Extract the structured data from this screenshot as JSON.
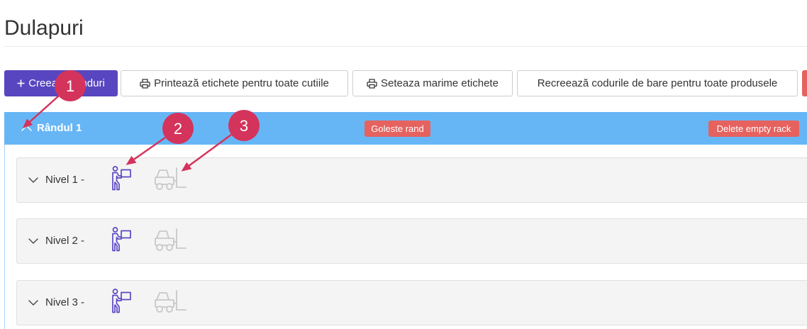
{
  "page": {
    "title": "Dulapuri"
  },
  "toolbar": {
    "create_label": "Creează rânduri",
    "print_all_label": "Printează etichete pentru toate cutiile",
    "label_size_label": "Seteaza marime etichete",
    "regen_barcodes_label": "Recreează codurile de bare pentru toate produsele"
  },
  "rack": {
    "title": "Rândul 1",
    "empty_row_label": "Goleste rand",
    "delete_rack_label": "Delete empty rack",
    "levels": [
      {
        "label": "Nivel 1 -"
      },
      {
        "label": "Nivel 2 -"
      },
      {
        "label": "Nivel 3 -"
      }
    ]
  },
  "annotations": [
    {
      "label": "1"
    },
    {
      "label": "2"
    },
    {
      "label": "3"
    }
  ],
  "icons": {
    "create": "plus-icon",
    "print": "printer-icon",
    "rack_collapse": "chevron-up-icon",
    "level_expand": "chevron-down-icon",
    "picking_location": "person-carrying-box-icon",
    "storage_location": "forklift-icon"
  },
  "colors": {
    "primary": "#5746c0",
    "rack_header": "#66b6f6",
    "danger": "#e5625f",
    "annotation": "#d4335c",
    "picking_icon": "#5a48c2",
    "forklift_icon": "#c8c8c8"
  }
}
